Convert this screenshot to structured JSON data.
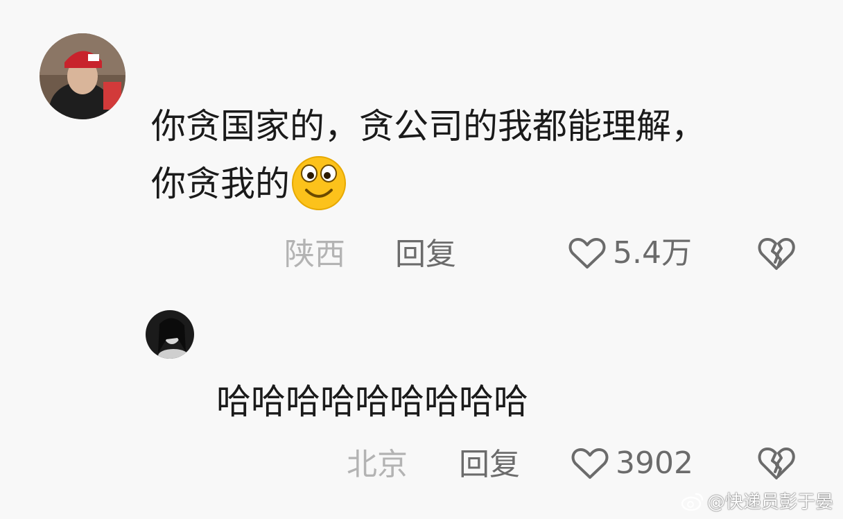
{
  "comments": [
    {
      "text_line1": "你贪国家的，贪公司的我都能理解，",
      "text_line2": "你贪我的",
      "location": "陕西",
      "reply_label": "回复",
      "like_count": "5.4万"
    },
    {
      "text": "哈哈哈哈哈哈哈哈哈",
      "location": "北京",
      "reply_label": "回复",
      "like_count": "3902"
    }
  ],
  "watermark": "@快递员彭于晏"
}
